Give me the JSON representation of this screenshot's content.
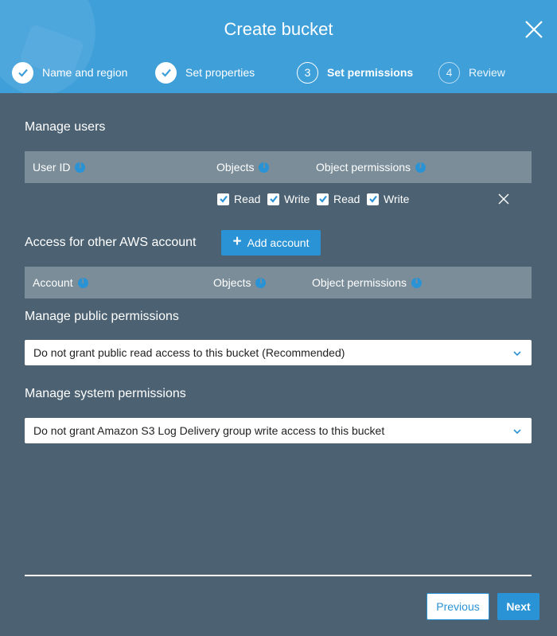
{
  "dialog": {
    "title": "Create bucket"
  },
  "steps": [
    {
      "label": "Name and region",
      "state": "done",
      "number": "1"
    },
    {
      "label": "Set properties",
      "state": "done",
      "number": "2"
    },
    {
      "label": "Set permissions",
      "state": "active",
      "number": "3"
    },
    {
      "label": "Review",
      "state": "pending",
      "number": "4"
    }
  ],
  "manage_users": {
    "title": "Manage users",
    "columns": {
      "user_id": "User ID",
      "objects": "Objects",
      "object_permissions": "Object permissions"
    },
    "row": {
      "objects_read": {
        "label": "Read",
        "checked": true
      },
      "objects_write": {
        "label": "Write",
        "checked": true
      },
      "perm_read": {
        "label": "Read",
        "checked": true
      },
      "perm_write": {
        "label": "Write",
        "checked": true
      }
    }
  },
  "other_accounts": {
    "title": "Access for other AWS account",
    "add_button": "Add account",
    "columns": {
      "account": "Account",
      "objects": "Objects",
      "object_permissions": "Object permissions"
    }
  },
  "public_permissions": {
    "title": "Manage public permissions",
    "selected": "Do not grant public read access to this bucket (Recommended)"
  },
  "system_permissions": {
    "title": "Manage system permissions",
    "selected": "Do not grant Amazon S3 Log Delivery group write access to this bucket"
  },
  "footer": {
    "previous": "Previous",
    "next": "Next"
  },
  "colors": {
    "header": "#3e9fd9",
    "body": "#4c6272",
    "accent": "#2a93d5",
    "table_header": "#7a8d99"
  }
}
